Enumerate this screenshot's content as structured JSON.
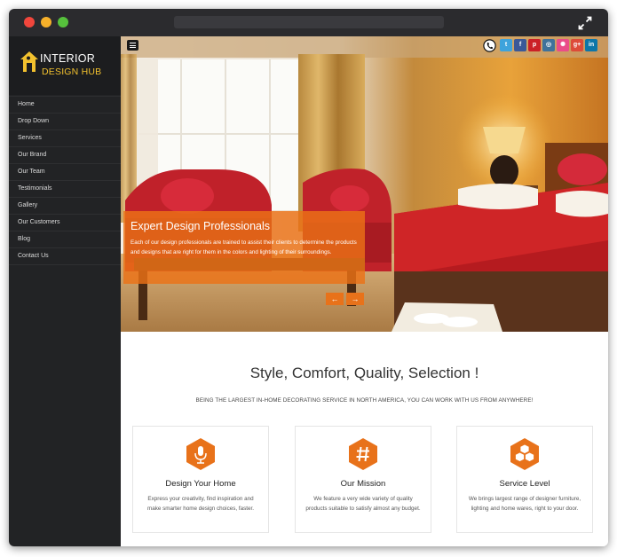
{
  "sidebar": {
    "logo": {
      "line1": "INTERIOR",
      "line2": "DESIGN HUB"
    },
    "items": [
      {
        "label": "Home"
      },
      {
        "label": "Drop Down"
      },
      {
        "label": "Services"
      },
      {
        "label": "Our Brand"
      },
      {
        "label": "Our Team"
      },
      {
        "label": "Testimonials"
      },
      {
        "label": "Gallery"
      },
      {
        "label": "Our Customers"
      },
      {
        "label": "Blog"
      },
      {
        "label": "Contact Us"
      }
    ]
  },
  "hero": {
    "caption_title": "Expert Design Professionals",
    "caption_text": "Each of our design professionals are trained to assist their clients to determine the products and designs that are right for them in the colors and lighting of their surroundings.",
    "prev_arrow": "←",
    "next_arrow": "→",
    "social": [
      {
        "name": "twitter-icon",
        "glyph": "t",
        "color": "#3ea3dc"
      },
      {
        "name": "facebook-icon",
        "glyph": "f",
        "color": "#3b5998"
      },
      {
        "name": "pinterest-icon",
        "glyph": "p",
        "color": "#cb2027"
      },
      {
        "name": "instagram-icon",
        "glyph": "◎",
        "color": "#3f729b"
      },
      {
        "name": "dribbble-icon",
        "glyph": "✺",
        "color": "#ea4c89"
      },
      {
        "name": "google-plus-icon",
        "glyph": "g+",
        "color": "#dd4b39"
      },
      {
        "name": "linkedin-icon",
        "glyph": "in",
        "color": "#0e76a8"
      }
    ]
  },
  "content": {
    "headline": "Style, Comfort, Quality, Selection !",
    "subline": "BEING THE LARGEST IN-HOME DECORATING SERVICE IN NORTH AMERICA, YOU CAN WORK WITH US FROM ANYWHERE!",
    "cards": [
      {
        "title": "Design Your Home",
        "desc": "Express your creativity, find inspiration and make smarter home design choices, faster.",
        "icon": "microphone-icon"
      },
      {
        "title": "Our Mission",
        "desc": "We feature a very wide variety of quality products suitable to satisfy almost any budget.",
        "icon": "hashtag-icon"
      },
      {
        "title": "Service Level",
        "desc": "We brings largest range of designer furniture, lighting and home wares, right to your door.",
        "icon": "cubes-icon"
      }
    ]
  },
  "colors": {
    "accent": "#e8721a",
    "sidebar": "#222325",
    "titlebar": "#2b2b2e"
  }
}
